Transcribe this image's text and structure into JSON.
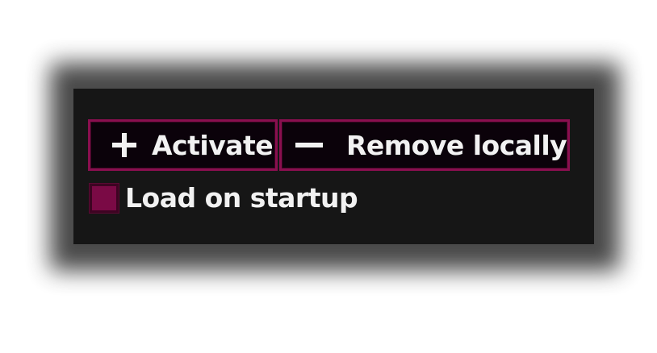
{
  "panel": {
    "activate_button": {
      "icon": "plus-icon",
      "label": "Activate"
    },
    "remove_button": {
      "icon": "minus-icon",
      "label": "Remove locally"
    },
    "load_on_startup": {
      "label": "Load on startup",
      "checked": false
    }
  },
  "colors": {
    "panel_background": "#161616",
    "accent_border": "#8a0f4f",
    "checkbox_fill": "#7a0a45",
    "text": "#f2f2f2"
  }
}
